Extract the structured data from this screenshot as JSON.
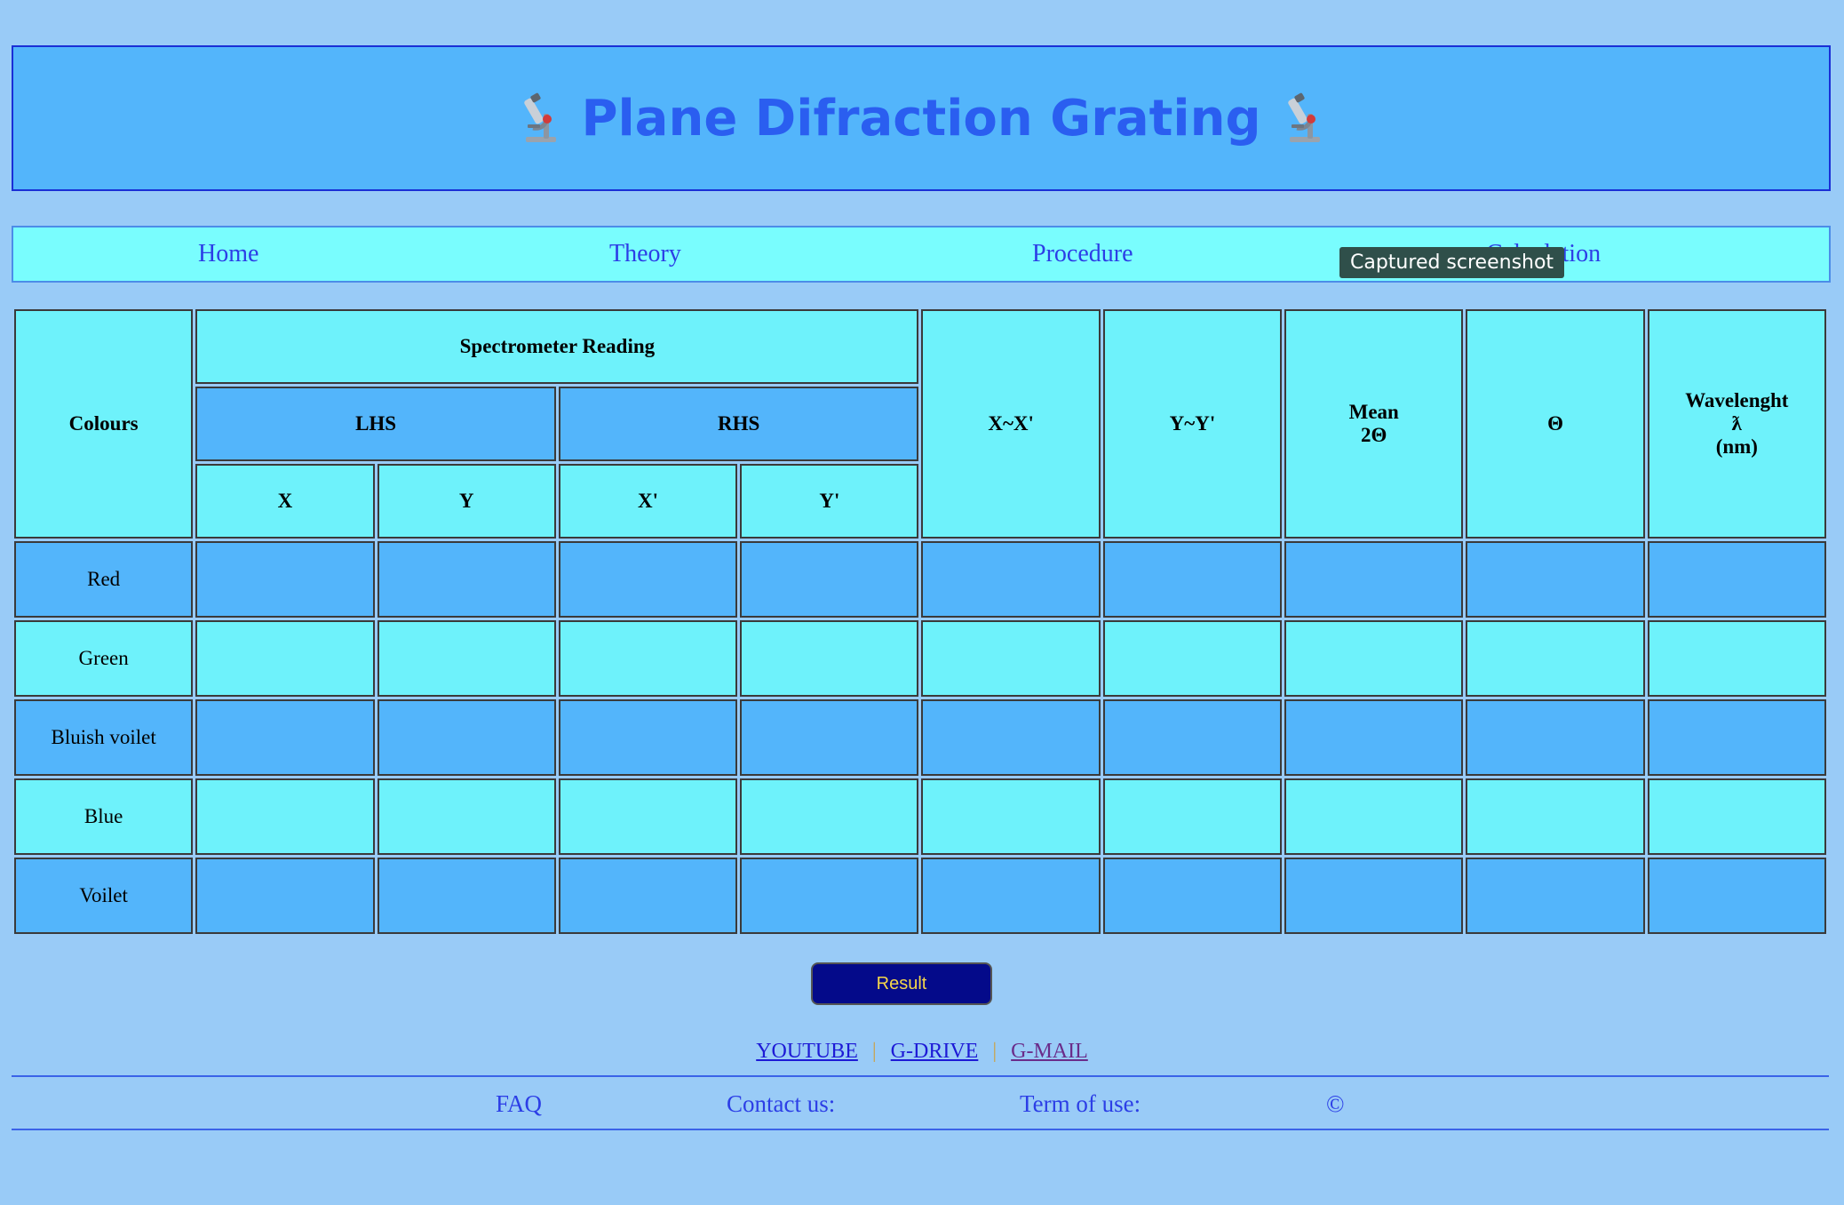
{
  "header": {
    "title": "Plane Difraction Grating",
    "icon_left": "microscope-icon",
    "icon_right": "microscope-icon"
  },
  "nav": {
    "items": [
      {
        "label": "Home"
      },
      {
        "label": "Theory"
      },
      {
        "label": "Procedure"
      },
      {
        "label": "Calculation"
      }
    ]
  },
  "tooltip": {
    "text": "Captured screenshot"
  },
  "table": {
    "headers": {
      "colours": "Colours",
      "spectrometer": "Spectrometer Reading",
      "lhs": "LHS",
      "rhs": "RHS",
      "x": "X",
      "y": "Y",
      "x_prime": "X'",
      "y_prime": "Y'",
      "x_diff": "X~X'",
      "y_diff": "Y~Y'",
      "mean_line1": "Mean",
      "mean_line2": "2Θ",
      "theta": "Θ",
      "wavelength_line1": "Wavelenght",
      "wavelength_line2": "ƛ",
      "wavelength_line3": "(nm)"
    },
    "rows": [
      {
        "colour": "Red"
      },
      {
        "colour": "Green"
      },
      {
        "colour": "Bluish voilet"
      },
      {
        "colour": "Blue"
      },
      {
        "colour": "Voilet"
      }
    ]
  },
  "result_button": {
    "label": "Result"
  },
  "links": {
    "youtube": "YOUTUBE",
    "gdrive": "G-DRIVE",
    "gmail": "G-MAIL",
    "separator": "|"
  },
  "footer": {
    "faq": "FAQ",
    "contact": "Contact us:",
    "terms": "Term of use:",
    "copyright": "©"
  },
  "colors": {
    "page_background": "#99cbf7",
    "header_background": "#53b5fb",
    "title_color": "#2a5ef0",
    "nav_background": "#79fdfe",
    "cell_light": "#6ef2fb",
    "cell_dark": "#53b5fb",
    "button_background": "#040a8a",
    "button_text": "#f5d74a"
  }
}
